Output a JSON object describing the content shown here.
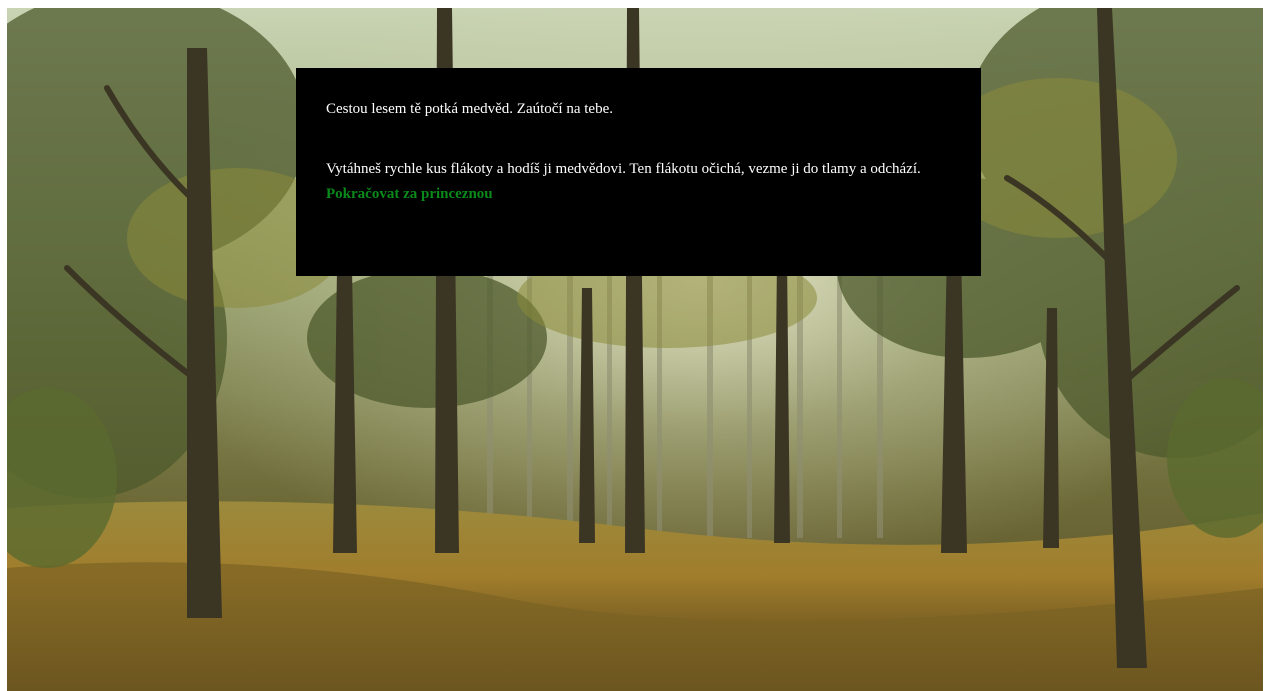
{
  "scene": {
    "background": "forest-scene",
    "colors": {
      "box_background": "#000000",
      "text": "#ffffff",
      "link": "#0a8a1a"
    }
  },
  "story": {
    "paragraph_1": "Cestou lesem tě potká medvěd. Zaútočí na tebe.",
    "paragraph_2": "Vytáhneš rychle kus flákoty a hodíš ji medvědovi. Ten flákotu očichá, vezme ji do tlamy a odchází.",
    "continue_label": "Pokračovat za princeznou"
  }
}
